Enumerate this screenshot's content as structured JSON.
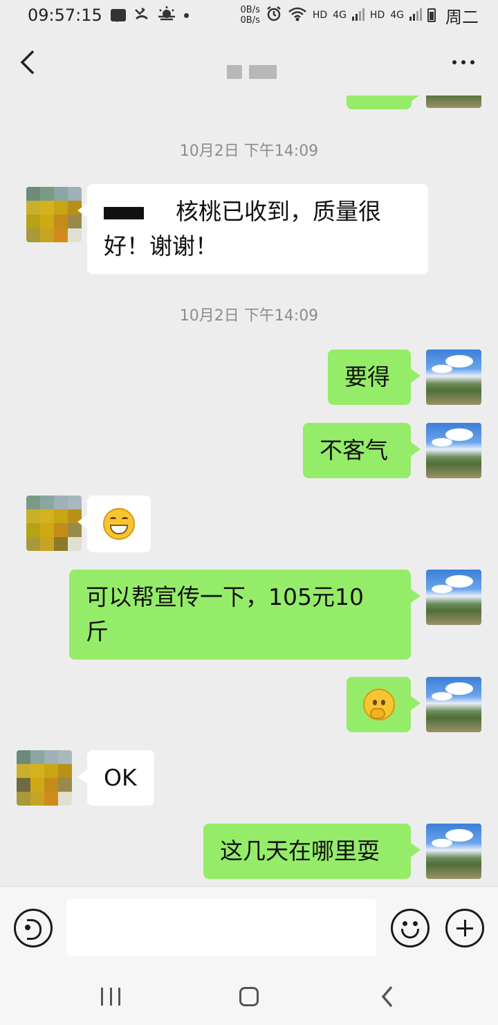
{
  "status_bar": {
    "time": "09:57:15",
    "net_up": "0B/s",
    "net_down": "0B/s",
    "hd1": "HD",
    "net1": "4G",
    "hd2": "HD",
    "net2": "4G",
    "weekday": "周二"
  },
  "chat": {
    "timestamps": [
      "10月2日 下午14:09",
      "10月2日 下午14:09"
    ],
    "messages": [
      {
        "side": "received",
        "line1": "核桃已收到，质量很",
        "line2": "好！谢谢！"
      },
      {
        "side": "sent",
        "text": "要得"
      },
      {
        "side": "sent",
        "text": "不客气"
      },
      {
        "side": "received",
        "emoji": "grin-emoji"
      },
      {
        "side": "sent",
        "line1": "可以帮宣传一下，105元10",
        "line2": "斤"
      },
      {
        "side": "sent",
        "emoji": "thinking-emoji"
      },
      {
        "side": "received",
        "text": "OK"
      },
      {
        "side": "sent",
        "text": "这几天在哪里耍"
      }
    ]
  },
  "input": {
    "placeholder": ""
  },
  "colors": {
    "sent_bubble": "#95ec69",
    "received_bubble": "#ffffff",
    "background": "#ededed"
  },
  "icons": {
    "back": "chevron-left-icon",
    "more": "more-dots-icon",
    "voice": "voice-icon",
    "emoji": "emoji-icon",
    "plus": "plus-icon"
  }
}
